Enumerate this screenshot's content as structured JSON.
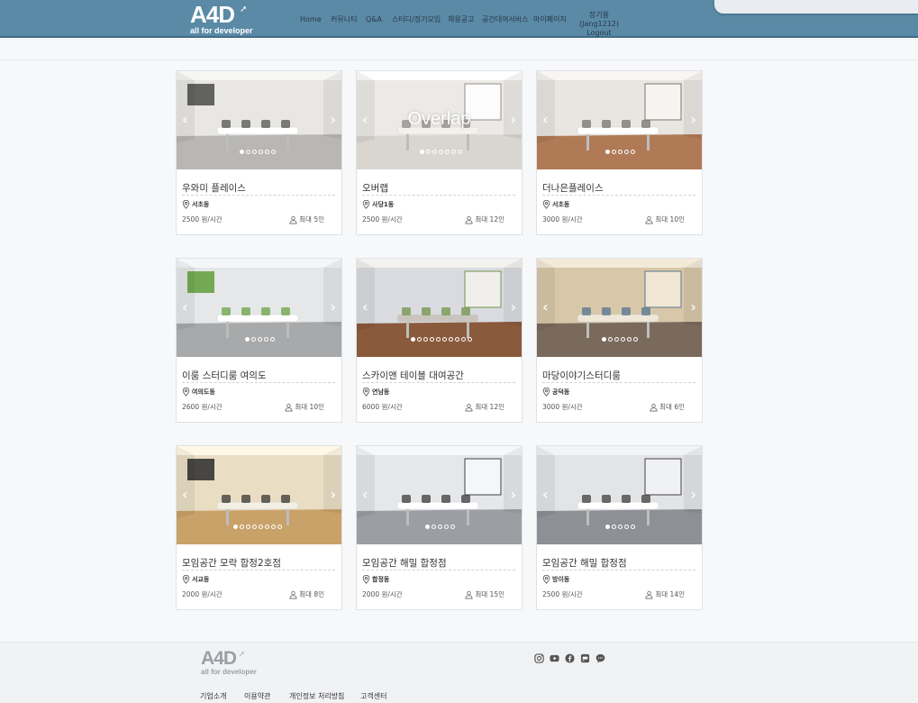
{
  "header": {
    "logo_main": "A4D",
    "logo_sub": "all for developer",
    "nav": [
      "Home",
      "커뮤니티",
      "Q&A",
      "스터디/정기모임",
      "채용공고",
      "공간대여서비스",
      "마이페이지"
    ],
    "user_name": "장기용(Jang1212)",
    "logout": "Logout"
  },
  "spaces": [
    {
      "name": "우와미 플레이스",
      "location": "서초동",
      "price": "2500 원/시간",
      "capacity": "최대 5인",
      "slides": 6,
      "image_text": ""
    },
    {
      "name": "오버랩",
      "location": "사당1동",
      "price": "2500 원/시간",
      "capacity": "최대 12인",
      "slides": 7,
      "image_text": "Overlap"
    },
    {
      "name": "더나은플레이스",
      "location": "서초동",
      "price": "3000 원/시간",
      "capacity": "최대 10인",
      "slides": 5,
      "image_text": ""
    },
    {
      "name": "이룸 스터디룸 여의도",
      "location": "여의도동",
      "price": "2600 원/시간",
      "capacity": "최대 10인",
      "slides": 5,
      "image_text": ""
    },
    {
      "name": "스카이앤 테이블 대여공간",
      "location": "연남동",
      "price": "6000 원/시간",
      "capacity": "최대 12인",
      "slides": 10,
      "image_text": ""
    },
    {
      "name": "마당이야기스터디룸",
      "location": "공덕동",
      "price": "3000 원/시간",
      "capacity": "최대 6인",
      "slides": 6,
      "image_text": ""
    },
    {
      "name": "모임공간 모락 합정2호점",
      "location": "서교동",
      "price": "2000 원/시간",
      "capacity": "최대 8인",
      "slides": 8,
      "image_text": ""
    },
    {
      "name": "모임공간 해밀 합정점",
      "location": "합정동",
      "price": "2000 원/시간",
      "capacity": "최대 15인",
      "slides": 5,
      "image_text": ""
    },
    {
      "name": "모임공간 해밀 합정점",
      "location": "방이동",
      "price": "2500 원/시간",
      "capacity": "최대 14인",
      "slides": 5,
      "image_text": ""
    }
  ],
  "footer": {
    "logo_main": "A4D",
    "logo_sub": "all for developer",
    "links": [
      "기업소개",
      "이용약관",
      "개인정보 처리방침",
      "고객센터"
    ],
    "social": [
      "instagram-icon",
      "youtube-icon",
      "facebook-icon",
      "blog-icon",
      "chat-icon"
    ]
  },
  "colors": {
    "header_bg": "#5a8aa6",
    "page_bg": "#f7f8fa"
  }
}
